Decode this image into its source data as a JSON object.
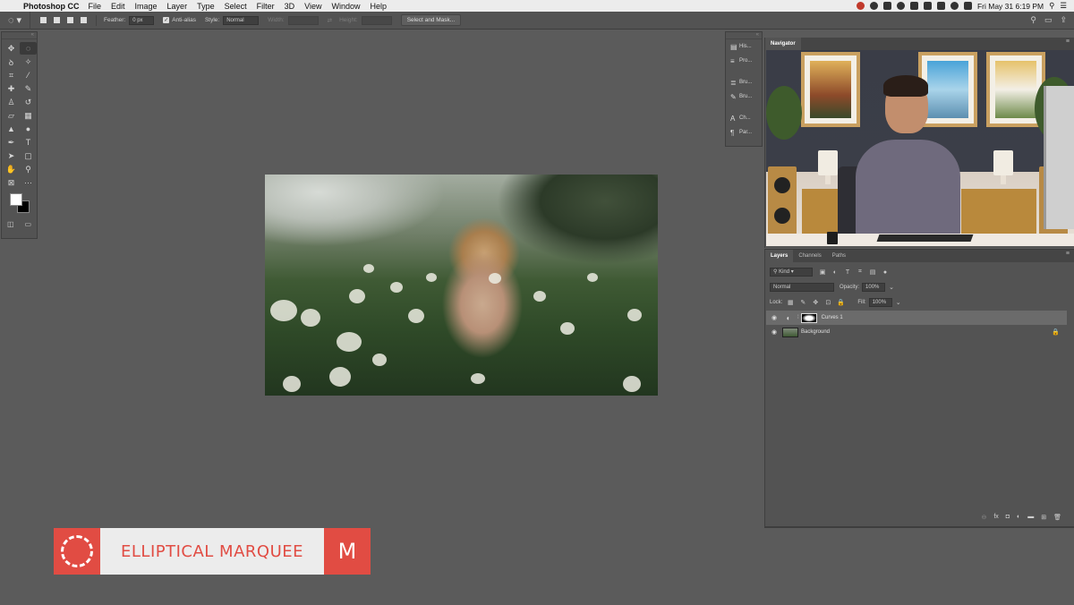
{
  "menubar": {
    "app": "Photoshop CC",
    "items": [
      "File",
      "Edit",
      "Image",
      "Layer",
      "Type",
      "Select",
      "Filter",
      "3D",
      "View",
      "Window",
      "Help"
    ],
    "clock": "Fri May 31  6:19 PM"
  },
  "options": {
    "feather_label": "Feather:",
    "feather_value": "0 px",
    "antialias_label": "Anti-alias",
    "style_label": "Style:",
    "style_value": "Normal",
    "width_label": "Width:",
    "height_label": "Height:",
    "select_mask": "Select and Mask..."
  },
  "strip": {
    "history": "His...",
    "properties": "Pro...",
    "brush1": "Bru...",
    "brush2": "Bru...",
    "character": "Ch...",
    "paragraph": "Par..."
  },
  "navigator": {
    "tab": "Navigator"
  },
  "layers": {
    "tabs": [
      "Layers",
      "Channels",
      "Paths"
    ],
    "kind": "Kind",
    "blend": "Normal",
    "opacity_label": "Opacity:",
    "opacity_value": "100%",
    "lock_label": "Lock:",
    "fill_label": "Fill:",
    "fill_value": "100%",
    "items": [
      {
        "name": "Curves 1"
      },
      {
        "name": "Background"
      }
    ]
  },
  "banner": {
    "title": "ELLIPTICAL MARQUEE",
    "shortcut": "M"
  },
  "colors": {
    "accent": "#e14c43",
    "panel": "#535353",
    "canvas": "#5b5b5b"
  }
}
